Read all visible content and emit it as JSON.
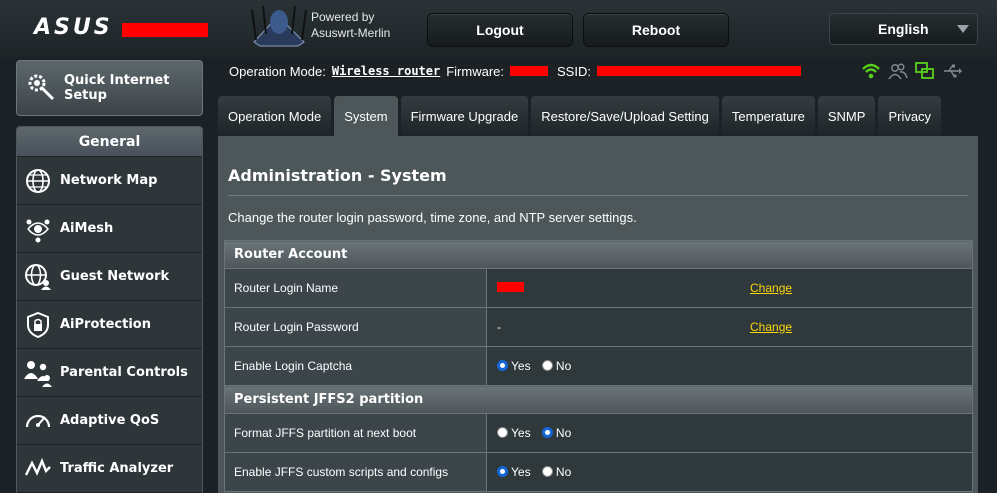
{
  "header": {
    "logo_text": "ASUS",
    "powered_by": "Powered by",
    "firmware_name": "Asuswrt-Merlin",
    "logout_label": "Logout",
    "reboot_label": "Reboot",
    "language": "English",
    "icons": [
      "router-icon",
      "chevron-down-icon"
    ]
  },
  "status_bar": {
    "operation_mode_label": "Operation Mode:",
    "operation_mode_value": "Wireless router",
    "firmware_label": "Firmware:",
    "ssid_label": "SSID:",
    "icons": [
      "wifi-icon",
      "users-icon",
      "network-icon",
      "usb-icon"
    ],
    "colors": {
      "wifi": "#59d11b",
      "network": "#59d11b"
    }
  },
  "sidebar": {
    "quick_setup_line1": "Quick Internet",
    "quick_setup_line2": "Setup",
    "section_title": "General",
    "items": [
      {
        "label": "Network Map",
        "icon": "globe-icon"
      },
      {
        "label": "AiMesh",
        "icon": "mesh-icon"
      },
      {
        "label": "Guest Network",
        "icon": "guest-globe-icon"
      },
      {
        "label": "AiProtection",
        "icon": "shield-lock-icon"
      },
      {
        "label": "Parental Controls",
        "icon": "family-icon"
      },
      {
        "label": "Adaptive QoS",
        "icon": "speedometer-icon"
      },
      {
        "label": "Traffic Analyzer",
        "icon": "traffic-icon"
      }
    ]
  },
  "tabs": [
    {
      "label": "Operation Mode",
      "active": false
    },
    {
      "label": "System",
      "active": true
    },
    {
      "label": "Firmware Upgrade",
      "active": false
    },
    {
      "label": "Restore/Save/Upload Setting",
      "active": false
    },
    {
      "label": "Temperature",
      "active": false
    },
    {
      "label": "SNMP",
      "active": false
    },
    {
      "label": "Privacy",
      "active": false
    }
  ],
  "main": {
    "title": "Administration - System",
    "description": "Change the router login password, time zone, and NTP server settings.",
    "router_account": {
      "header": "Router Account",
      "login_name_label": "Router Login Name",
      "login_name_change": "Change",
      "login_password_label": "Router Login Password",
      "login_password_value": "-",
      "login_password_change": "Change",
      "captcha_label": "Enable Login Captcha",
      "captcha_value": "Yes"
    },
    "jffs": {
      "header": "Persistent JFFS2 partition",
      "format_label": "Format JFFS partition at next boot",
      "format_value": "No",
      "scripts_label": "Enable JFFS custom scripts and configs",
      "scripts_value": "Yes"
    },
    "yes_label": "Yes",
    "no_label": "No",
    "colors": {
      "link": "#fbd60a",
      "radio_selected": "#1566d6"
    }
  }
}
